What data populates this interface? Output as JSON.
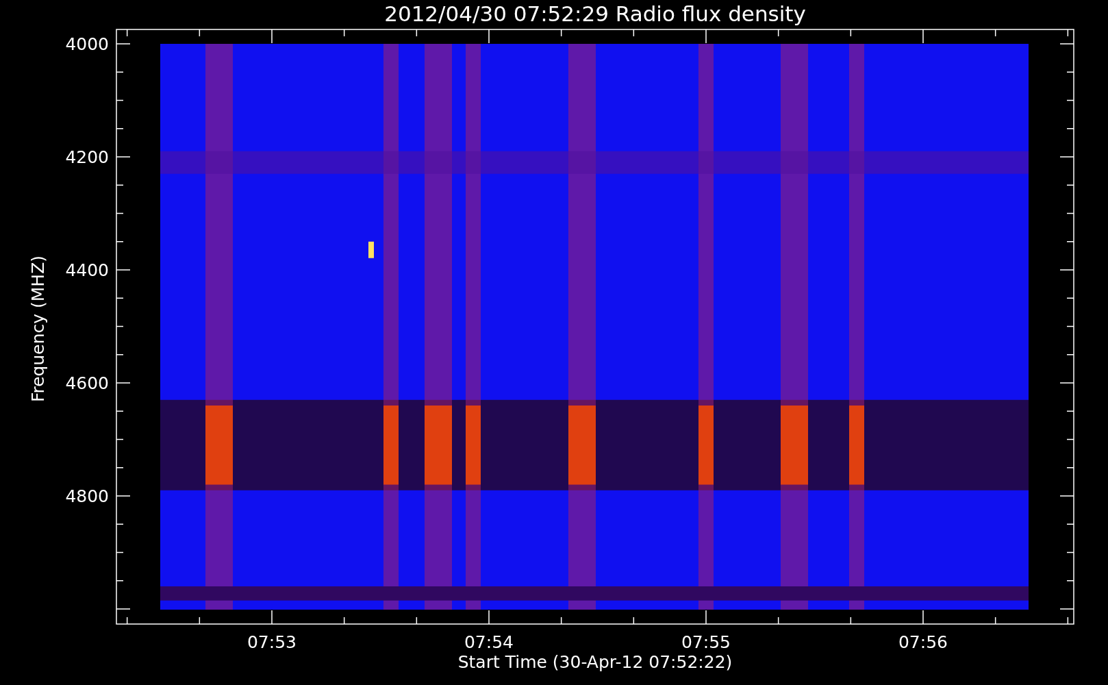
{
  "title": "2012/04/30 07:52:29 Radio flux density",
  "y_axis": {
    "label": "Frequency (MHZ)",
    "ticks": [
      "4000",
      "4200",
      "4400",
      "4600",
      "4800"
    ]
  },
  "x_axis": {
    "label": "Start Time (30-Apr-12 07:52:22)",
    "ticks": [
      "07:53",
      "07:54",
      "07:55",
      "07:56"
    ]
  }
}
